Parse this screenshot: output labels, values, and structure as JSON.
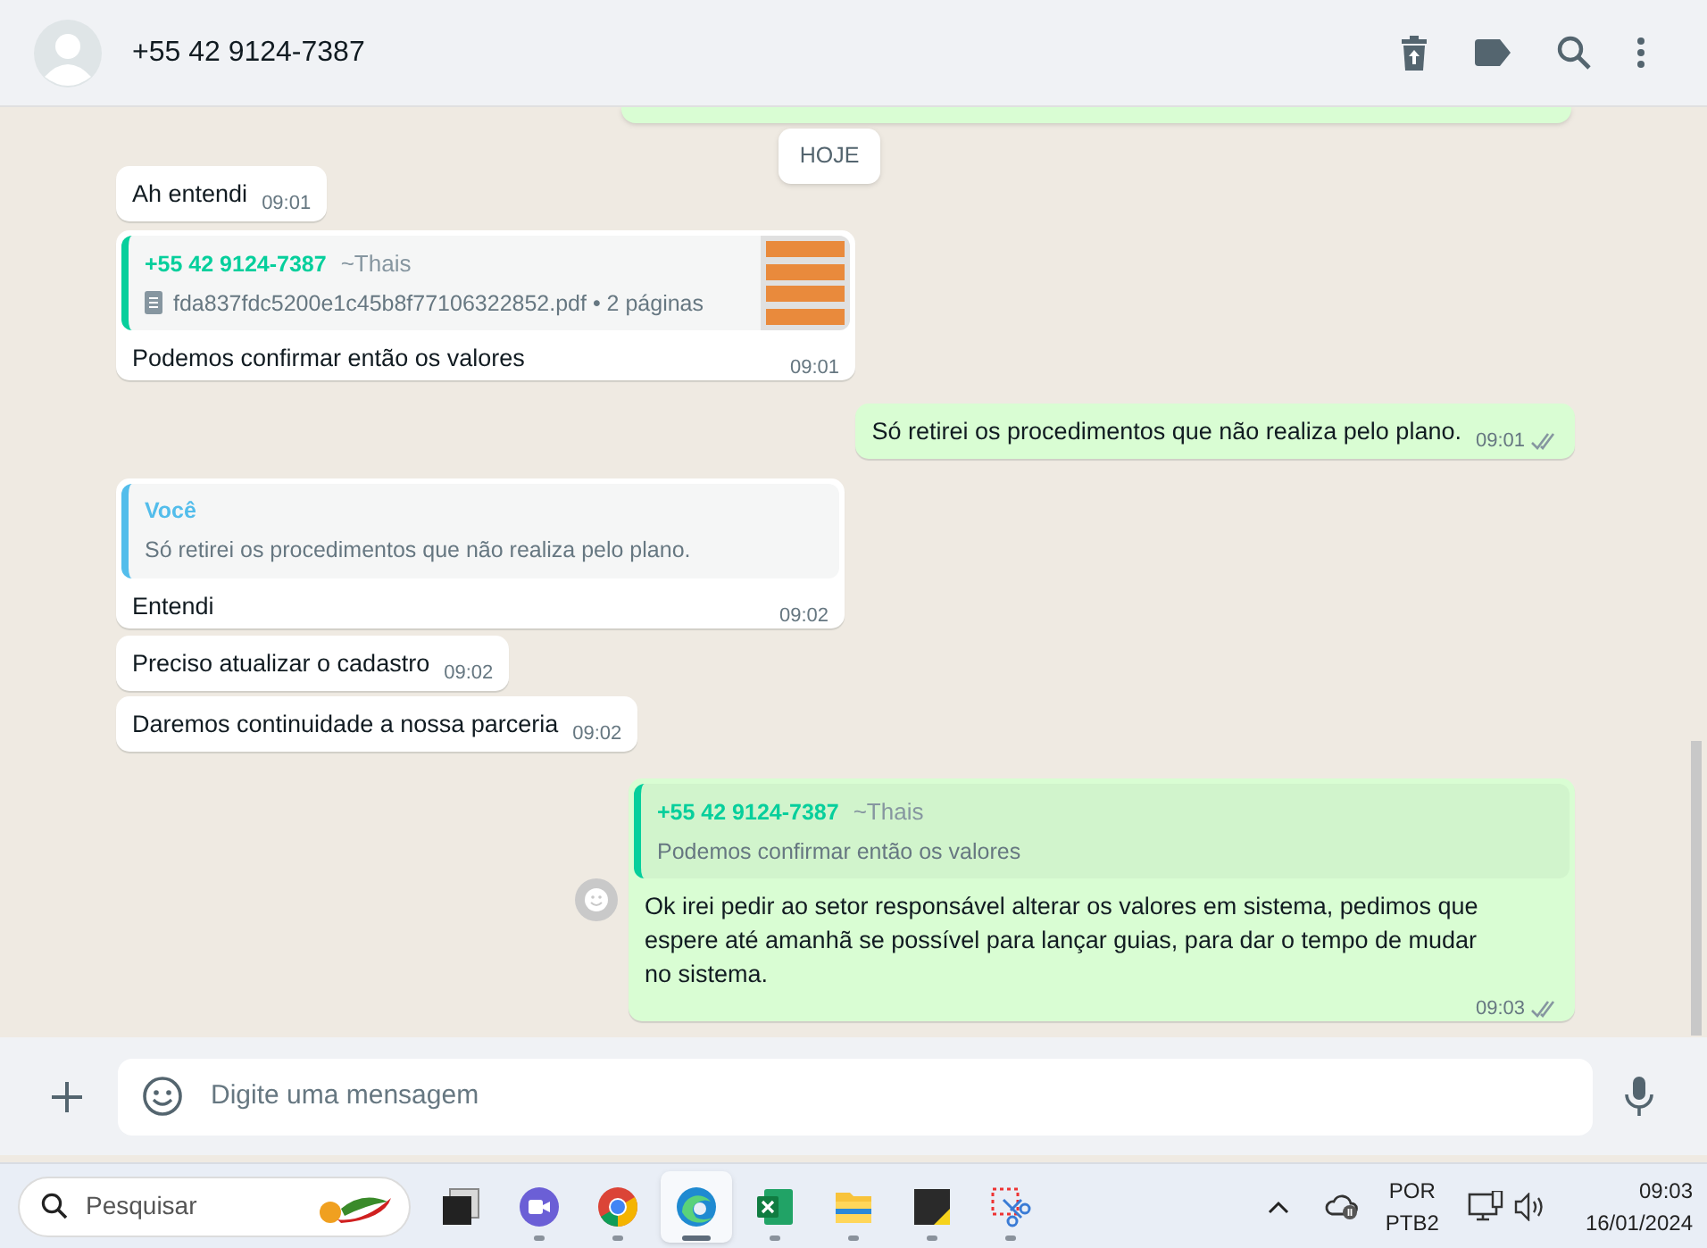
{
  "header": {
    "contact": "+55 42 9124-7387"
  },
  "date_chip": "HOJE",
  "messages": [
    {
      "kind": "incoming",
      "text": "Ah entendi",
      "time": "09:01"
    },
    {
      "kind": "incoming",
      "document": {
        "author": "+55 42 9124-7387",
        "alias": "~Thais",
        "filename": "fda837fdc5200e1c45b8f77106322852.pdf • 2 páginas"
      },
      "text": "Podemos confirmar então os valores",
      "time": "09:01"
    },
    {
      "kind": "outgoing",
      "text": "Só retirei os procedimentos que não realiza pelo plano.",
      "time": "09:01",
      "delivered": true
    },
    {
      "kind": "incoming",
      "quote": {
        "author": "Você",
        "text": "Só retirei os procedimentos que não realiza pelo plano."
      },
      "text": "Entendi",
      "time": "09:02"
    },
    {
      "kind": "incoming",
      "text": "Preciso atualizar o cadastro",
      "time": "09:02"
    },
    {
      "kind": "incoming",
      "text": "Daremos continuidade a nossa parceria",
      "time": "09:02"
    },
    {
      "kind": "outgoing",
      "quote": {
        "author": "+55 42 9124-7387",
        "alias": "~Thais",
        "text": "Podemos confirmar então os valores"
      },
      "text": "Ok irei pedir ao setor responsável alterar os valores em sistema, pedimos que espere até amanhã se possível para lançar guias, para dar o tempo de mudar no sistema.",
      "time": "09:03",
      "delivered": true,
      "react_button": true
    }
  ],
  "composer": {
    "placeholder": "Digite uma mensagem"
  },
  "taskbar": {
    "search_placeholder": "Pesquisar",
    "apps": [
      {
        "kind": "taskview",
        "selected": false
      },
      {
        "kind": "chat",
        "selected": false
      },
      {
        "kind": "chrome",
        "selected": false
      },
      {
        "kind": "edge",
        "selected": true
      },
      {
        "kind": "excel",
        "selected": false
      },
      {
        "kind": "folder",
        "selected": false
      },
      {
        "kind": "notes",
        "selected": false
      },
      {
        "kind": "snip",
        "selected": false
      }
    ],
    "language": "POR",
    "layout": "PTB2",
    "time": "09:03",
    "date": "16/01/2024"
  }
}
